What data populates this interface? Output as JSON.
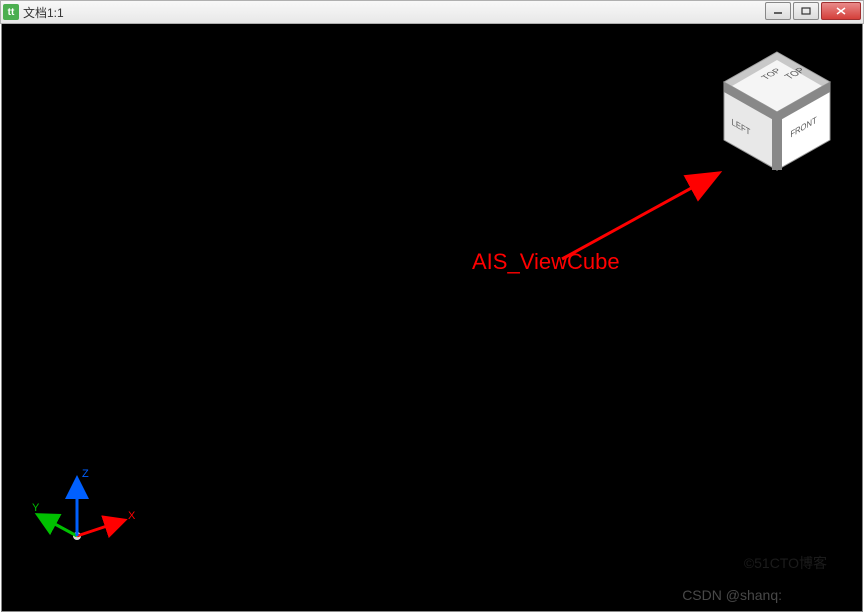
{
  "window": {
    "title": "文档1:1",
    "app_icon_text": "tt"
  },
  "viewcube": {
    "top": "TOP",
    "left": "LEFT",
    "front": "FRONT"
  },
  "triad": {
    "x_label": "X",
    "y_label": "Y",
    "z_label": "Z"
  },
  "annotation": {
    "label": "AIS_ViewCube"
  },
  "watermark": {
    "csdn": "CSDN @shanq:",
    "cto": "©51CTO博客"
  }
}
